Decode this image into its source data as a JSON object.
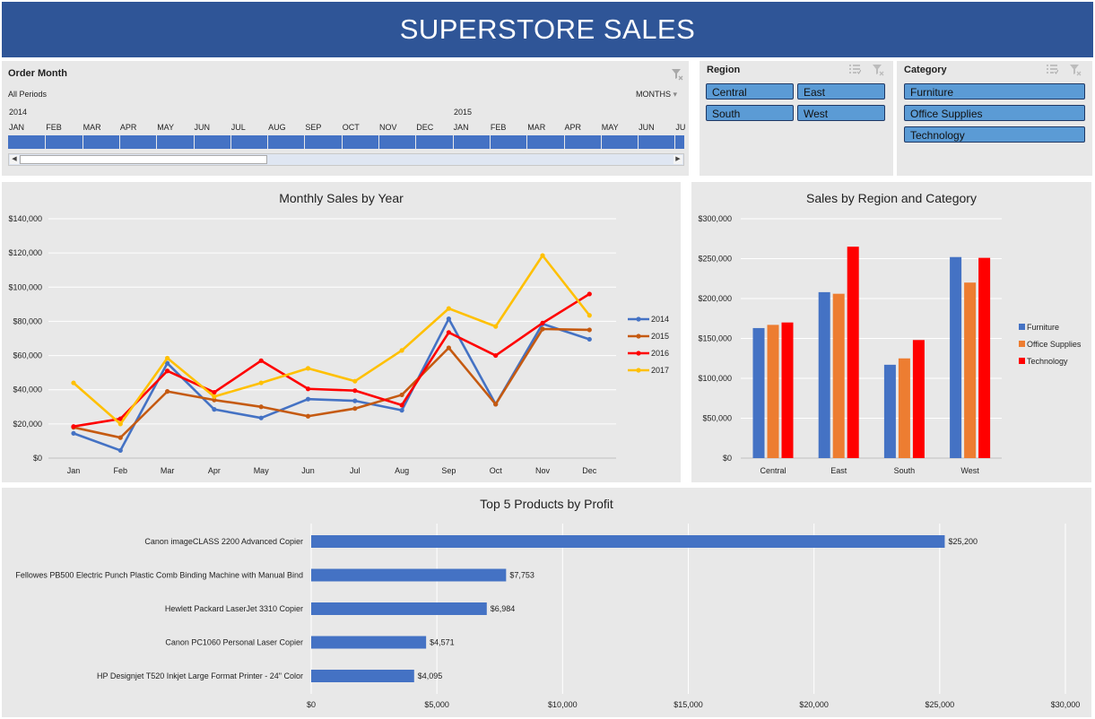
{
  "header": {
    "title": "SUPERSTORE SALES"
  },
  "timeline": {
    "title": "Order Month",
    "period_label": "All Periods",
    "level_label": "MONTHS",
    "years": [
      "2014",
      "2015"
    ],
    "months": [
      "JAN",
      "FEB",
      "MAR",
      "APR",
      "MAY",
      "JUN",
      "JUL",
      "AUG",
      "SEP",
      "OCT",
      "NOV",
      "DEC",
      "JAN",
      "FEB",
      "MAR",
      "APR",
      "MAY",
      "JUN",
      "JU"
    ]
  },
  "region_slicer": {
    "title": "Region",
    "items": [
      "Central",
      "East",
      "South",
      "West"
    ]
  },
  "category_slicer": {
    "title": "Category",
    "items": [
      "Furniture",
      "Office Supplies",
      "Technology"
    ]
  },
  "colors": {
    "banner": "#2f5597",
    "blue": "#4472c4",
    "orange": "#ed7d31",
    "red": "#ff0000",
    "gold": "#ffc000",
    "slicer": "#5b9bd5"
  },
  "chart_data": [
    {
      "type": "line",
      "title": "Monthly Sales by Year",
      "categories": [
        "Jan",
        "Feb",
        "Mar",
        "Apr",
        "May",
        "Jun",
        "Jul",
        "Aug",
        "Sep",
        "Oct",
        "Nov",
        "Dec"
      ],
      "y_ticks": [
        "$0",
        "$20,000",
        "$40,000",
        "$60,000",
        "$80,000",
        "$100,000",
        "$120,000",
        "$140,000"
      ],
      "ylim": [
        0,
        140000
      ],
      "grid": true,
      "legend": "right",
      "series": [
        {
          "name": "2014",
          "color": "#4472c4",
          "values": [
            14500,
            4500,
            55500,
            28500,
            23500,
            34500,
            33500,
            28000,
            81500,
            31500,
            78500,
            69500
          ]
        },
        {
          "name": "2015",
          "color": "#c55a11",
          "values": [
            18000,
            12000,
            39000,
            34000,
            30000,
            24500,
            29000,
            37000,
            64500,
            31500,
            75500,
            75000
          ]
        },
        {
          "name": "2016",
          "color": "#ff0000",
          "values": [
            18500,
            23000,
            51000,
            38500,
            57000,
            40500,
            39500,
            31000,
            73500,
            60000,
            79000,
            96000
          ]
        },
        {
          "name": "2017",
          "color": "#ffc000",
          "values": [
            44000,
            20000,
            58500,
            36000,
            44000,
            52500,
            45000,
            63000,
            87500,
            77000,
            118500,
            83500
          ]
        }
      ]
    },
    {
      "type": "bar",
      "title": "Sales by Region and Category",
      "categories": [
        "Central",
        "East",
        "South",
        "West"
      ],
      "y_ticks": [
        "$0",
        "$50,000",
        "$100,000",
        "$150,000",
        "$200,000",
        "$250,000",
        "$300,000"
      ],
      "ylim": [
        0,
        300000
      ],
      "grid": true,
      "legend": "right",
      "series": [
        {
          "name": "Furniture",
          "color": "#4472c4",
          "values": [
            163000,
            208000,
            117000,
            252000
          ]
        },
        {
          "name": "Office Supplies",
          "color": "#ed7d31",
          "values": [
            167000,
            206000,
            125000,
            220000
          ]
        },
        {
          "name": "Technology",
          "color": "#ff0000",
          "values": [
            170000,
            265000,
            148000,
            251000
          ]
        }
      ]
    },
    {
      "type": "bar",
      "orientation": "horizontal",
      "title": "Top 5 Products by Profit",
      "categories": [
        "Canon imageCLASS 2200 Advanced Copier",
        "Fellowes PB500 Electric Punch Plastic Comb Binding Machine with Manual Bind",
        "Hewlett Packard LaserJet 3310 Copier",
        "Canon PC1060 Personal Laser Copier",
        "HP Designjet T520 Inkjet Large Format Printer - 24\" Color"
      ],
      "values": [
        25200,
        7753,
        6984,
        4571,
        4095
      ],
      "value_labels": [
        "$25,200",
        "$7,753",
        "$6,984",
        "$4,571",
        "$4,095"
      ],
      "x_ticks": [
        "$0",
        "$5,000",
        "$10,000",
        "$15,000",
        "$20,000",
        "$25,000",
        "$30,000"
      ],
      "xlim": [
        0,
        30000
      ],
      "grid": true,
      "color": "#4472c4"
    }
  ]
}
